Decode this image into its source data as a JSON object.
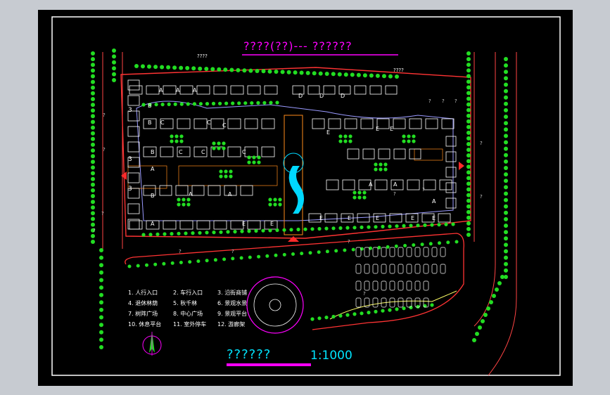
{
  "window": {
    "background": "#c7cbd1",
    "canvas_background": "#000000"
  },
  "drawing": {
    "title": "????(??)---  ??????",
    "top_labels": [
      "????",
      "????"
    ],
    "scale_title": "??????",
    "scale": "1:1000",
    "building_types": [
      "A",
      "B",
      "C",
      "D",
      "E"
    ],
    "building_numbers": [
      "3"
    ],
    "question_marks": [
      "?",
      "?",
      "?",
      "?",
      "?",
      "?",
      "?",
      "?",
      "?",
      "?",
      "?",
      "?",
      "?",
      "?",
      "?"
    ]
  },
  "legend": [
    {
      "num": "1",
      "text": "人行入口"
    },
    {
      "num": "2",
      "text": "车行入口"
    },
    {
      "num": "3",
      "text": "沿街商铺"
    },
    {
      "num": "4",
      "text": "退休林荫"
    },
    {
      "num": "5",
      "text": "秋千林"
    },
    {
      "num": "6",
      "text": "景观水景"
    },
    {
      "num": "7",
      "text": "树阵广场"
    },
    {
      "num": "8",
      "text": "中心广场"
    },
    {
      "num": "9",
      "text": "景观平台"
    },
    {
      "num": "10",
      "text": "休息平台"
    },
    {
      "num": "11",
      "text": "室外停车"
    },
    {
      "num": "12",
      "text": "游廊架"
    }
  ],
  "colors": {
    "title": "#ff00ff",
    "scale": "#00e5ff",
    "trees": "#22dd22",
    "buildings": "#ffffff",
    "road_outline": "#ff3333",
    "plaza": "#ff8c1a",
    "water": "#00d8ff",
    "compass": "#ff00ff"
  }
}
